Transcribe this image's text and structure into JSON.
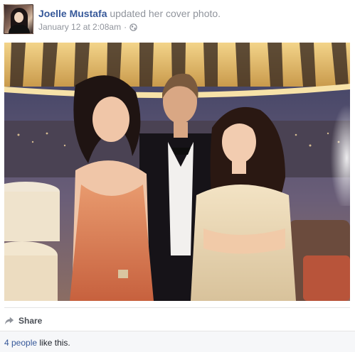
{
  "post": {
    "author": "Joelle Mustafa",
    "action": "updated her cover photo.",
    "date": "January 12 at 2:08am",
    "separator": "·",
    "privacy_icon": "globe-icon"
  },
  "footer": {
    "share_label": "Share",
    "share_icon": "share-arrow-icon",
    "likes_count": "4 people",
    "likes_suffix": "like this."
  },
  "colors": {
    "link_blue": "#365899",
    "meta_gray": "#90949c"
  }
}
